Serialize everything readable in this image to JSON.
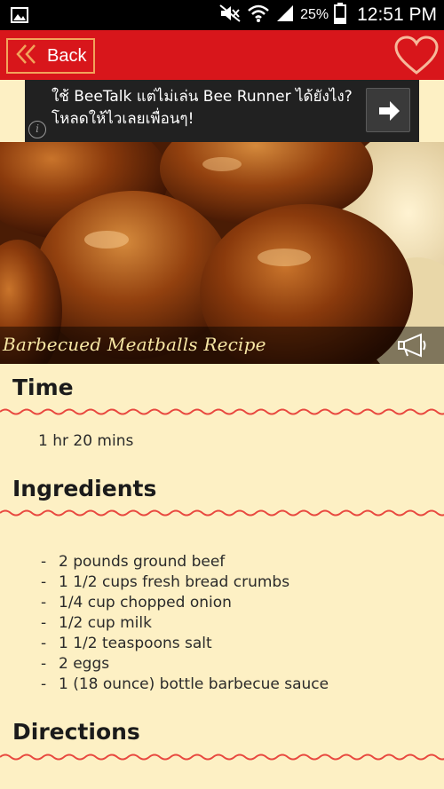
{
  "status_bar": {
    "battery": "25%",
    "time": "12:51 PM"
  },
  "app_bar": {
    "back_label": "Back"
  },
  "ad": {
    "text": "ใช้ BeeTalk แต่ไม่เล่น Bee Runner ได้ยังไง? โหลดให้ไวเลยเพื่อนๆ!",
    "info_glyph": "i"
  },
  "recipe": {
    "title": "Barbecued Meatballs Recipe",
    "time_heading": "Time",
    "time_value": "1 hr 20 mins",
    "ingredients_heading": "Ingredients",
    "ingredients": [
      "2 pounds ground beef",
      "1 1/2 cups fresh bread crumbs",
      "1/4 cup chopped onion",
      "1/2 cup milk",
      "1 1/2 teaspoons salt",
      "2 eggs",
      "1 (18 ounce) bottle barbecue sauce"
    ],
    "directions_heading": "Directions"
  },
  "colors": {
    "app_bar": "#d8161b",
    "background": "#fdf0c4",
    "wave": "#e8483f",
    "heart": "#f6b89a"
  }
}
